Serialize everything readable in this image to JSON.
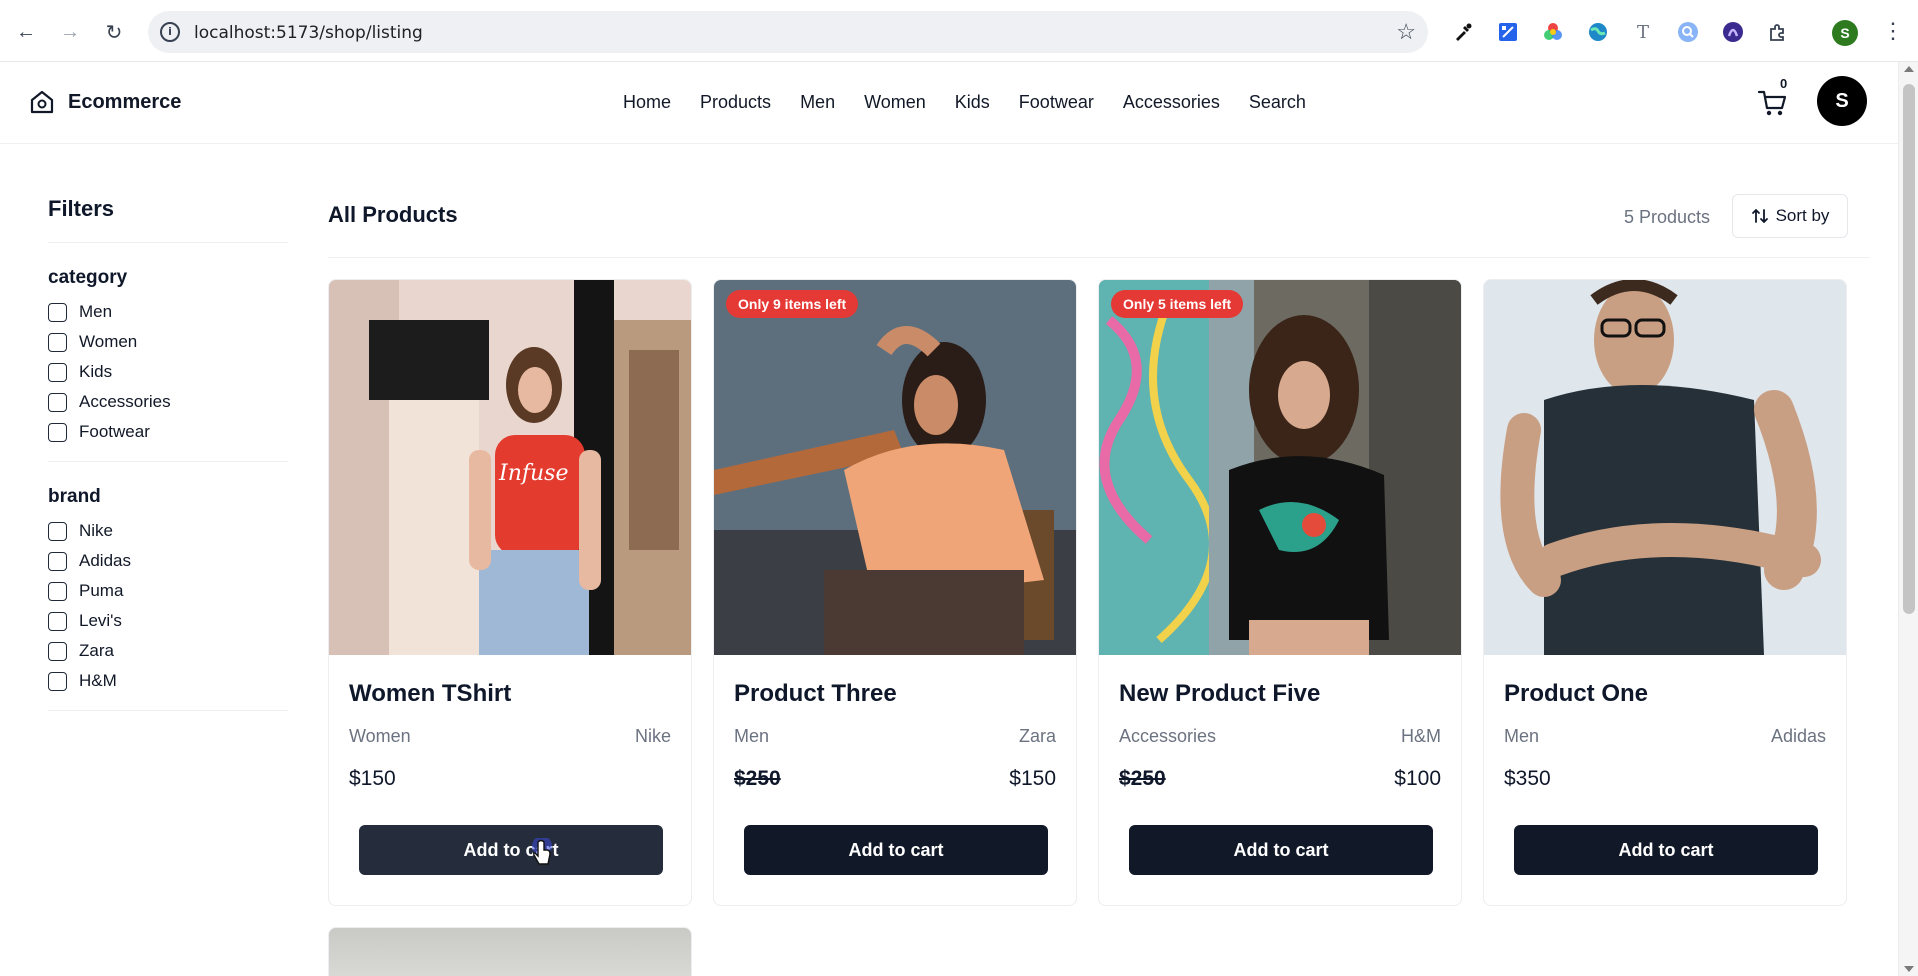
{
  "browser": {
    "url": "localhost:5173/shop/listing",
    "profile_initial": "S",
    "nav": {
      "back": "←",
      "forward": "→",
      "reload": "↻"
    },
    "extensions": [
      "eyedropper-icon",
      "page-ruler-icon",
      "color-wheel-icon",
      "globe-icon",
      "text-icon",
      "search-ext-icon",
      "arc-icon",
      "puzzle-icon"
    ]
  },
  "header": {
    "brand": "Ecommerce",
    "nav": [
      "Home",
      "Products",
      "Men",
      "Women",
      "Kids",
      "Footwear",
      "Accessories",
      "Search"
    ],
    "cart_count": "0",
    "avatar_initial": "S"
  },
  "filters": {
    "title": "Filters",
    "groups": [
      {
        "name": "category",
        "options": [
          "Men",
          "Women",
          "Kids",
          "Accessories",
          "Footwear"
        ]
      },
      {
        "name": "brand",
        "options": [
          "Nike",
          "Adidas",
          "Puma",
          "Levi's",
          "Zara",
          "H&M"
        ]
      }
    ]
  },
  "listing": {
    "title": "All Products",
    "count": "5 Products",
    "sort_label": "Sort by",
    "products": [
      {
        "title": "Women TShirt",
        "category": "Women",
        "brand": "Nike",
        "price": "$150",
        "sale_price": "",
        "badge": "",
        "button": "Add to cart"
      },
      {
        "title": "Product Three",
        "category": "Men",
        "brand": "Zara",
        "price": "$250",
        "sale_price": "$150",
        "badge": "Only 9 items left",
        "button": "Add to cart"
      },
      {
        "title": "New Product Five",
        "category": "Accessories",
        "brand": "H&M",
        "price": "$250",
        "sale_price": "$100",
        "badge": "Only 5 items left",
        "button": "Add to cart"
      },
      {
        "title": "Product One",
        "category": "Men",
        "brand": "Adidas",
        "price": "$350",
        "sale_price": "",
        "badge": "",
        "button": "Add to cart"
      }
    ]
  },
  "colors": {
    "primary_button": "#111827",
    "badge": "#e53935",
    "muted_text": "#6b7280"
  }
}
